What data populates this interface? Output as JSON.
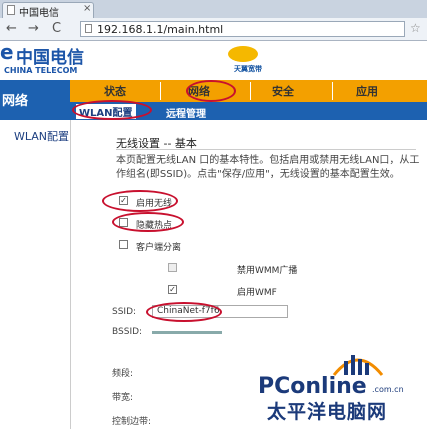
{
  "browser": {
    "tab_title": "中国电信",
    "tab_close": "×",
    "back": "←",
    "forward": "→",
    "reload": "C",
    "url": "192.168.1.1/main.html",
    "bookmark_star": "☆"
  },
  "header": {
    "logo_e": "e",
    "logo_cn": "中国电信",
    "logo_en": "CHINA TELECOM",
    "brand_small": "天翼宽带"
  },
  "menu": {
    "items": [
      "状态",
      "网络",
      "安全",
      "应用"
    ],
    "left_title": "网络",
    "subitems": [
      "WLAN配置",
      "远程管理"
    ]
  },
  "left_panel": {
    "item": "WLAN配置"
  },
  "content": {
    "title": "无线设置 -- 基本",
    "desc": "本页配置无线LAN 口的基本特性。包括启用或禁用无线LAN口，从工作组名(即SSID)。点击\"保存/应用\"，无线设置的基本配置生效。",
    "enable_wireless": "启用无线",
    "hide_ap": "隐藏热点",
    "client_isolation": "客户端分离",
    "disable_wmm": "禁用WMM广播",
    "enable_wmf": "启用WMF",
    "ssid_label": "SSID:",
    "ssid_value": "ChinaNet-f7f6",
    "bssid_label": "BSSID:",
    "channel_label": "频段:",
    "bandwidth_label": "带宽:",
    "sideband_label": "控制边带:"
  },
  "checkboxes": {
    "enable_wireless": true,
    "hide_ap": false,
    "client_isolation": false,
    "disable_wmm": false,
    "enable_wmf": true
  },
  "watermark": {
    "brand": "PConline",
    "domain": ".com.cn",
    "cn": "太平洋电脑网"
  },
  "colors": {
    "menu_orange": "#f3a000",
    "nav_blue": "#1d61b0",
    "annotation_red": "#c8102e"
  }
}
